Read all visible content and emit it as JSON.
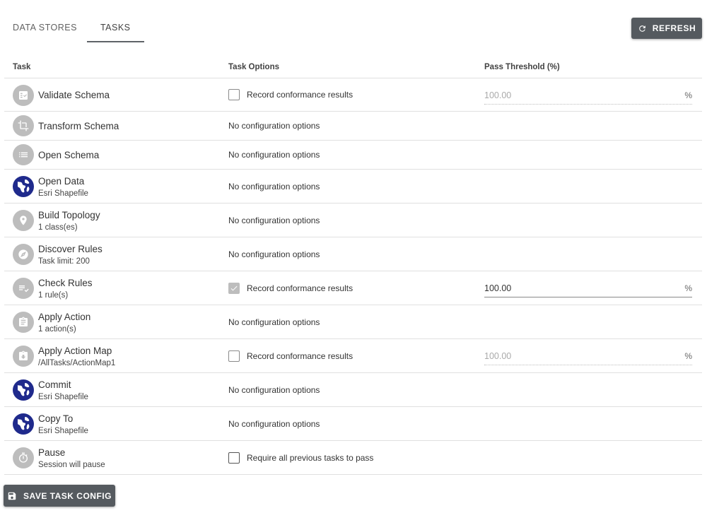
{
  "tabs": [
    {
      "label": "DATA STORES",
      "active": false
    },
    {
      "label": "TASKS",
      "active": true
    }
  ],
  "refresh_label": "REFRESH",
  "columns": {
    "task": "Task",
    "options": "Task Options",
    "threshold": "Pass Threshold (%)"
  },
  "rows": [
    {
      "name": "Validate Schema",
      "sub": "",
      "icon": "validate-schema-icon",
      "option": "Record conformance results",
      "checkbox": "unchecked",
      "threshold": "100.00",
      "unit": "%",
      "threshold_enabled": false
    },
    {
      "name": "Transform Schema",
      "sub": "",
      "icon": "crop-icon",
      "option": "No configuration options"
    },
    {
      "name": "Open Schema",
      "sub": "",
      "icon": "list-icon",
      "option": "No configuration options"
    },
    {
      "name": "Open Data",
      "sub": "Esri Shapefile",
      "icon": "globe-icon",
      "option": "No configuration options"
    },
    {
      "name": "Build Topology",
      "sub": "1 class(es)",
      "icon": "pin-icon",
      "option": "No configuration options"
    },
    {
      "name": "Discover Rules",
      "sub": "Task limit: 200",
      "icon": "compass-icon",
      "option": "No configuration options"
    },
    {
      "name": "Check Rules",
      "sub": "1 rule(s)",
      "icon": "checklist-icon",
      "option": "Record conformance results",
      "checkbox": "checked",
      "threshold": "100.00",
      "unit": "%",
      "threshold_enabled": true
    },
    {
      "name": "Apply Action",
      "sub": "1 action(s)",
      "icon": "clipboard-icon",
      "option": "No configuration options"
    },
    {
      "name": "Apply Action Map",
      "sub": "/AllTasks/ActionMap1",
      "icon": "clipboard-download-icon",
      "option": "Record conformance results",
      "checkbox": "unchecked",
      "threshold": "100.00",
      "unit": "%",
      "threshold_enabled": false
    },
    {
      "name": "Commit",
      "sub": "Esri Shapefile",
      "icon": "globe-icon",
      "option": "No configuration options"
    },
    {
      "name": "Copy To",
      "sub": "Esri Shapefile",
      "icon": "globe-icon",
      "option": "No configuration options"
    },
    {
      "name": "Pause",
      "sub": "Session will pause",
      "icon": "timer-icon",
      "option": "Require all previous tasks to pass",
      "checkbox": "unchecked-dark"
    }
  ],
  "save_label": "SAVE TASK CONFIG",
  "colors": {
    "button_bg": "#555a5f",
    "icon_bg": "#bdbdbd",
    "globe_bg": "#1f2a8c"
  }
}
